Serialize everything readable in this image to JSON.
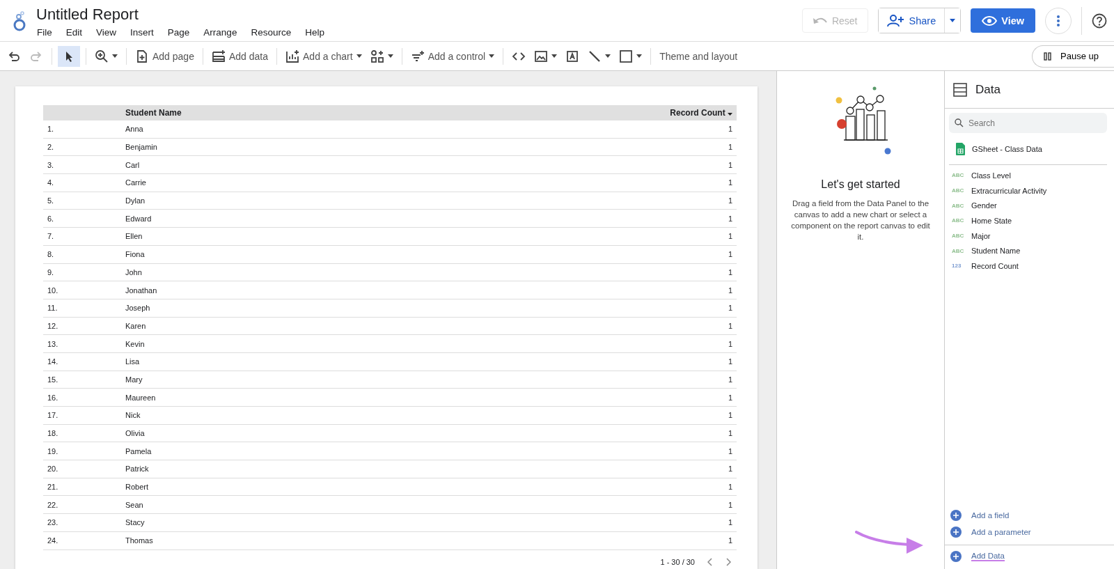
{
  "header": {
    "title": "Untitled Report",
    "menu": [
      "File",
      "Edit",
      "View",
      "Insert",
      "Page",
      "Arrange",
      "Resource",
      "Help"
    ],
    "reset": {
      "label": "Reset",
      "disabled": true
    },
    "share": "Share",
    "view": "View"
  },
  "toolbar": [
    {
      "kind": "icon",
      "disabled": false
    },
    {
      "kind": "icon",
      "disabled": true
    },
    {
      "kind": "sep"
    },
    {
      "kind": "icon",
      "selected": true
    },
    {
      "kind": "sep"
    },
    {
      "kind": "icon",
      "caret": true
    },
    {
      "kind": "sep"
    },
    {
      "kind": "text",
      "label": "Add page"
    },
    {
      "kind": "sep"
    },
    {
      "kind": "text",
      "label": "Add data"
    },
    {
      "kind": "sep"
    },
    {
      "kind": "text",
      "label": "Add a chart",
      "caret": true
    },
    {
      "kind": "icon",
      "caret": true
    },
    {
      "kind": "sep"
    },
    {
      "kind": "text",
      "label": "Add a control",
      "caret": true
    },
    {
      "kind": "sep"
    },
    {
      "kind": "icon"
    },
    {
      "kind": "icon",
      "caret": true
    },
    {
      "kind": "icon"
    },
    {
      "kind": "icon",
      "caret": true
    },
    {
      "kind": "icon",
      "caret": true
    },
    {
      "kind": "sep"
    },
    {
      "kind": "text",
      "label": "Theme and layout"
    }
  ],
  "pause": "Pause up",
  "table": {
    "columns": [
      "Student Name",
      "Record Count"
    ],
    "rows": [
      {
        "index": "1.",
        "name": "Anna",
        "count": "1"
      },
      {
        "index": "2.",
        "name": "Benjamin",
        "count": "1"
      },
      {
        "index": "3.",
        "name": "Carl",
        "count": "1"
      },
      {
        "index": "4.",
        "name": "Carrie",
        "count": "1"
      },
      {
        "index": "5.",
        "name": "Dylan",
        "count": "1"
      },
      {
        "index": "6.",
        "name": "Edward",
        "count": "1"
      },
      {
        "index": "7.",
        "name": "Ellen",
        "count": "1"
      },
      {
        "index": "8.",
        "name": "Fiona",
        "count": "1"
      },
      {
        "index": "9.",
        "name": "John",
        "count": "1"
      },
      {
        "index": "10.",
        "name": "Jonathan",
        "count": "1"
      },
      {
        "index": "11.",
        "name": "Joseph",
        "count": "1"
      },
      {
        "index": "12.",
        "name": "Karen",
        "count": "1"
      },
      {
        "index": "13.",
        "name": "Kevin",
        "count": "1"
      },
      {
        "index": "14.",
        "name": "Lisa",
        "count": "1"
      },
      {
        "index": "15.",
        "name": "Mary",
        "count": "1"
      },
      {
        "index": "16.",
        "name": "Maureen",
        "count": "1"
      },
      {
        "index": "17.",
        "name": "Nick",
        "count": "1"
      },
      {
        "index": "18.",
        "name": "Olivia",
        "count": "1"
      },
      {
        "index": "19.",
        "name": "Pamela",
        "count": "1"
      },
      {
        "index": "20.",
        "name": "Patrick",
        "count": "1"
      },
      {
        "index": "21.",
        "name": "Robert",
        "count": "1"
      },
      {
        "index": "22.",
        "name": "Sean",
        "count": "1"
      },
      {
        "index": "23.",
        "name": "Stacy",
        "count": "1"
      },
      {
        "index": "24.",
        "name": "Thomas",
        "count": "1"
      }
    ],
    "pagination": "1 - 30 / 30"
  },
  "properties": {
    "heading": "Let's get started",
    "text": "Drag a field from the Data Panel to the canvas to add a new chart or select a component on the report canvas to edit it."
  },
  "data_panel": {
    "title": "Data",
    "search": {
      "placeholder": "Search"
    },
    "source": "GSheet - Class Data",
    "fields": [
      {
        "kind": "text",
        "type_label": "ABC",
        "name": "Class Level"
      },
      {
        "kind": "text",
        "type_label": "ABC",
        "name": "Extracurricular Activity"
      },
      {
        "kind": "text",
        "type_label": "ABC",
        "name": "Gender"
      },
      {
        "kind": "text",
        "type_label": "ABC",
        "name": "Home State"
      },
      {
        "kind": "text",
        "type_label": "ABC",
        "name": "Major"
      },
      {
        "kind": "text",
        "type_label": "ABC",
        "name": "Student Name"
      },
      {
        "kind": "number",
        "type_label": "123",
        "name": "Record Count"
      }
    ],
    "actions": [
      "Add a field",
      "Add a parameter"
    ],
    "add_data": "Add Data"
  }
}
